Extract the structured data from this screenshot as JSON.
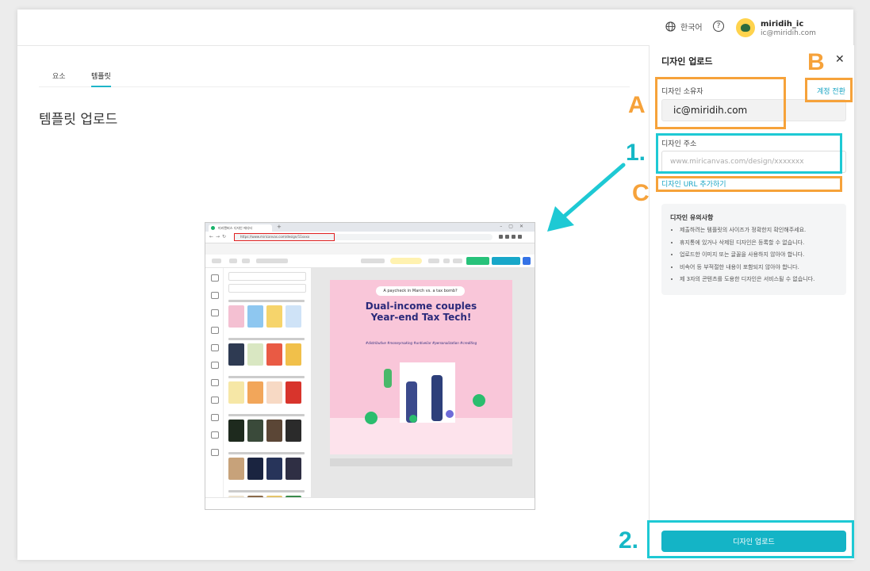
{
  "header": {
    "language": "한국어",
    "user_name": "miridih_ic",
    "user_email": "ic@miridih.com"
  },
  "tabs": [
    {
      "label": "요소"
    },
    {
      "label": "템플릿"
    }
  ],
  "page_title": "템플릿 업로드",
  "preview": {
    "browser_tab": "미리캔버스 디자인 에디터",
    "url": "https://www.miricanvas.com/design/11xxxx",
    "design_pill": "A paycheck in March vs. a tax bomb?",
    "design_headline_line1": "Dual-income couples",
    "design_headline_line2": "Year-end Tax Tech!",
    "design_tags": "#distributive #moneymaking #untiveliar #personalization #crediting"
  },
  "panel": {
    "title": "디자인 업로드",
    "owner_label": "디자인 소유자",
    "owner_value": "ic@miridih.com",
    "switch_account": "계정 전환",
    "url_label": "디자인 주소",
    "url_placeholder": "www.miricanvas.com/design/xxxxxxx",
    "add_url": "디자인 URL 추가하기",
    "notes_title": "디자인 유의사항",
    "notes": [
      "제출하려는 템플릿의 사이즈가 정확한지 확인해주세요.",
      "휴지통에 있거나 삭제된 디자인은 등록할 수 없습니다.",
      "업로드한 이미지 또는 글꼴을 사용하지 않아야 합니다.",
      "비속어 등 부적절한 내용이 포함되지 않아야 합니다.",
      "제 3자의 콘텐츠를 도용한 디자인은 서비스될 수 없습니다."
    ],
    "upload_button": "디자인 업로드"
  },
  "annotations": {
    "a": "A",
    "b": "B",
    "c": "C",
    "step1": "1.",
    "step2": "2."
  },
  "colors": {
    "accent": "#14b4c6",
    "annotation_orange": "#f6a23a",
    "annotation_cyan": "#1ec9d4"
  }
}
